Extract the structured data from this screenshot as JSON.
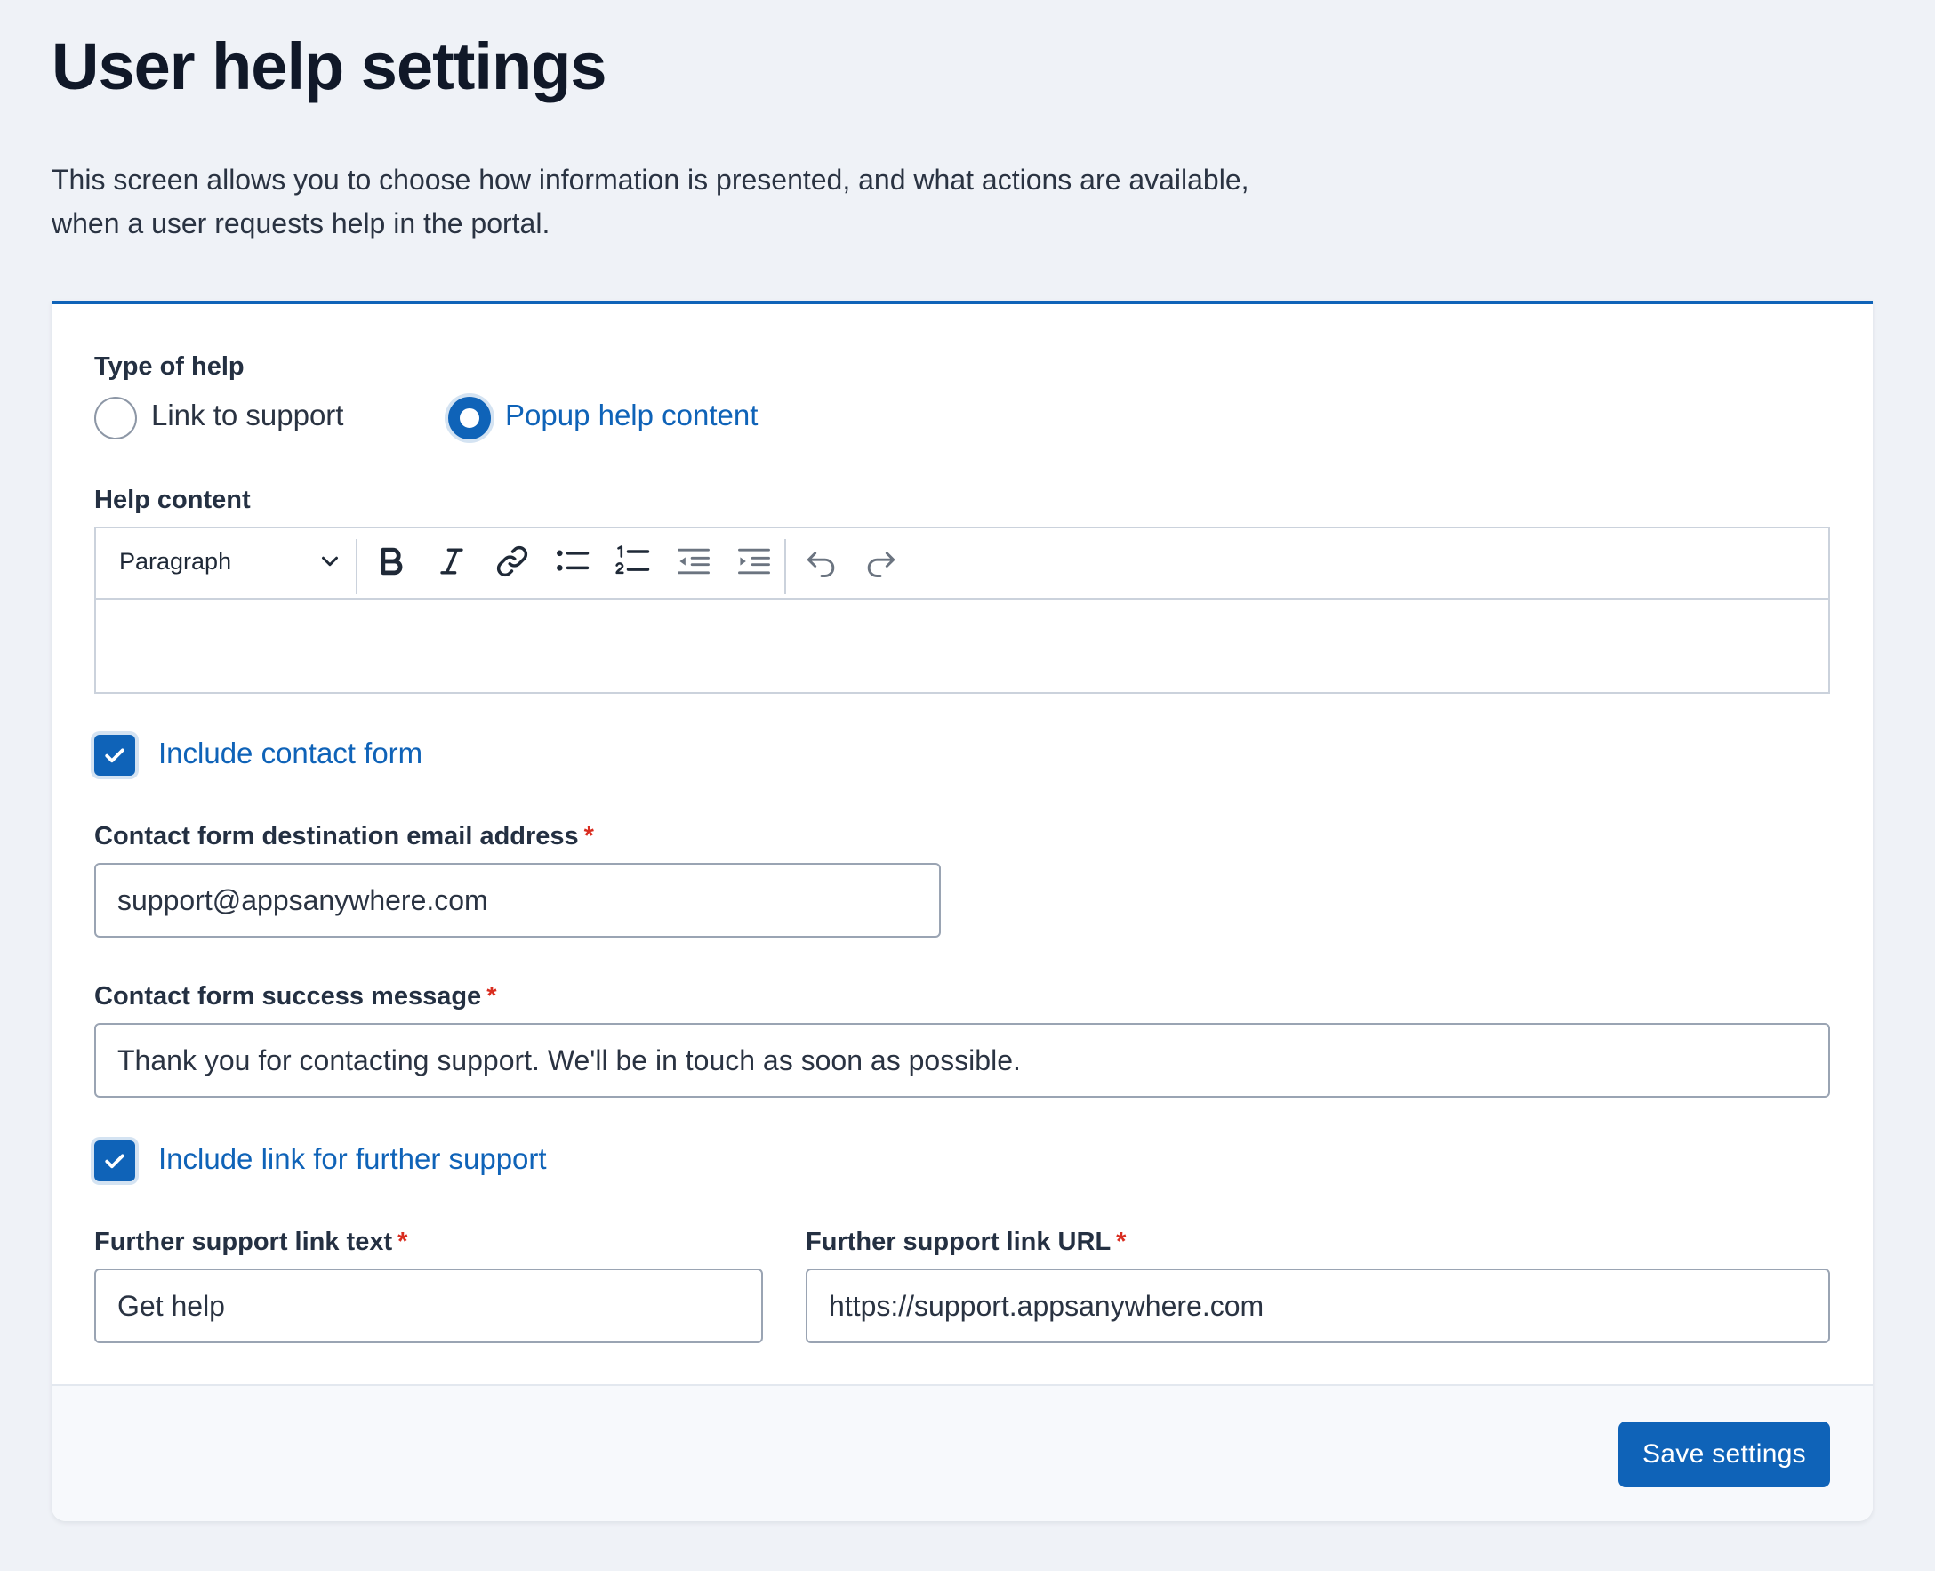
{
  "page": {
    "title": "User help settings",
    "intro": "This screen allows you to choose how information is presented, and what actions are available, when a user requests help in the portal."
  },
  "help_type": {
    "label": "Type of help",
    "options": [
      {
        "label": "Link to support",
        "selected": false
      },
      {
        "label": "Popup help content",
        "selected": true
      }
    ]
  },
  "help_content": {
    "label": "Help content",
    "format_select": "Paragraph",
    "toolbar_icons": [
      "bold-icon",
      "italic-icon",
      "link-icon",
      "bulleted-list-icon",
      "numbered-list-icon",
      "outdent-icon",
      "indent-icon",
      "undo-icon",
      "redo-icon"
    ],
    "value": ""
  },
  "contact_form": {
    "include_label": "Include contact form",
    "include_checked": true,
    "email_label": "Contact form destination email address",
    "email_value": "support@appsanywhere.com",
    "success_label": "Contact form success message",
    "success_value": "Thank you for contacting support. We'll be in touch as soon as possible."
  },
  "further_support": {
    "include_label": "Include link for further support",
    "include_checked": true,
    "text_label": "Further support link text",
    "text_value": "Get help",
    "url_label": "Further support link URL",
    "url_value": "https://support.appsanywhere.com"
  },
  "required_marker": "*",
  "actions": {
    "save_label": "Save settings"
  },
  "colors": {
    "accent": "#0f63b8",
    "required": "#d92d20",
    "background": "#eff2f7"
  }
}
